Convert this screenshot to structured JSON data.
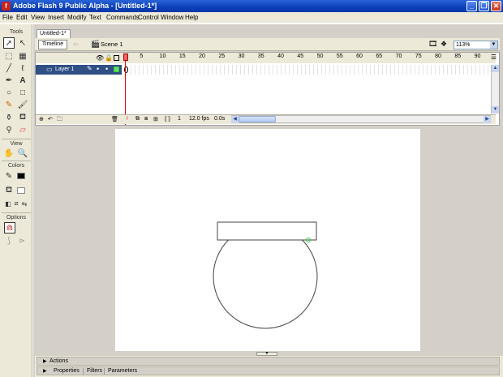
{
  "window": {
    "title": "Adobe Flash 9 Public Alpha - [Untitled-1*]"
  },
  "menu": [
    "File",
    "Edit",
    "View",
    "Insert",
    "Modify",
    "Text",
    "Commands",
    "Control",
    "Window",
    "Help"
  ],
  "tools": {
    "title": "Tools",
    "view_title": "View",
    "colors_title": "Colors",
    "options_title": "Options"
  },
  "document": {
    "tab": "Untitled-1*",
    "timeline_button": "Timeline",
    "scene": "Scene 1",
    "zoom": "113%"
  },
  "timeline": {
    "frame_numbers": [
      "1",
      "5",
      "10",
      "15",
      "20",
      "25",
      "30",
      "35",
      "40",
      "45",
      "50",
      "55",
      "60",
      "65",
      "70",
      "75",
      "80",
      "85",
      "90"
    ],
    "layer_name": "Layer 1",
    "current_frame": "1",
    "fps": "12.0 fps",
    "time": "0.0s"
  },
  "panels": {
    "actions": "Actions",
    "properties_tabs": [
      "Properties",
      "Filters",
      "Parameters"
    ]
  }
}
